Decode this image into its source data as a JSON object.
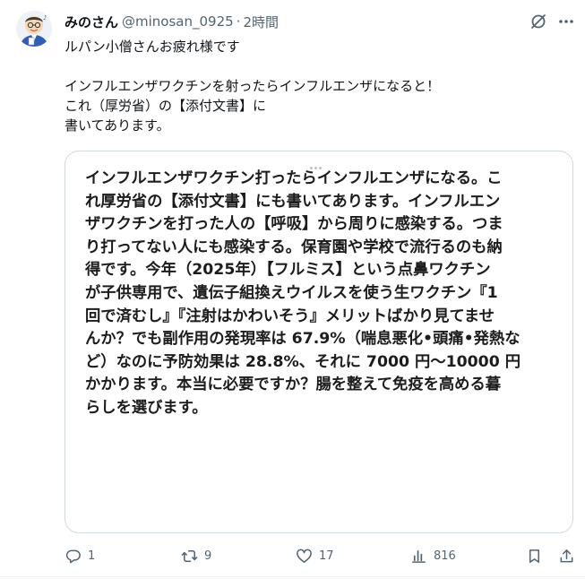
{
  "tweet": {
    "author": {
      "display_name": "みのさん",
      "handle": "@minosan_0925",
      "separator": "·",
      "time": "2時間"
    },
    "text_lines": [
      "ルパン小僧さんお疲れ様です",
      "",
      "インフルエンザワクチンを射ったらインフルエンザになると！",
      "これ（厚労省）の【添付文書】に",
      "書いてあります。"
    ],
    "media_text_lines": [
      "インフルエンザワクチン打ったらインフルエンザになる。こ",
      "れ厚労省の【添付文書】にも書いてあります。インフルエン",
      "ザワクチンを打った人の【呼吸】から周りに感染する。つま",
      "り打ってない人にも感染する。保育園や学校で流行るのも納",
      "得です。今年（2025年）【フルミス】という点鼻ワクチン",
      "が子供専用で、遺伝子組換えウイルスを使う生ワクチン『1",
      "回で済むし』『注射はかわいそう』メリットばかり見てませ",
      "んか？でも副作用の発現率は 67.9%（喘息悪化•頭痛•発熱な",
      "ど）なのに予防効果は 28.8%、それに 7000 円〜10000 円",
      "かかります。本当に必要ですか？腸を整えて免疫を高める暮",
      "らしを選びます。"
    ],
    "actions": {
      "replies": "1",
      "reposts": "9",
      "likes": "17",
      "views": "816"
    },
    "icons": [
      "avatar",
      "grok-icon",
      "more-icon",
      "reply-icon",
      "repost-icon",
      "like-icon",
      "views-icon",
      "bookmark-icon",
      "share-icon"
    ],
    "colors": {
      "text": "#0f1419",
      "secondary": "#536471",
      "border": "#cfd9de"
    }
  }
}
